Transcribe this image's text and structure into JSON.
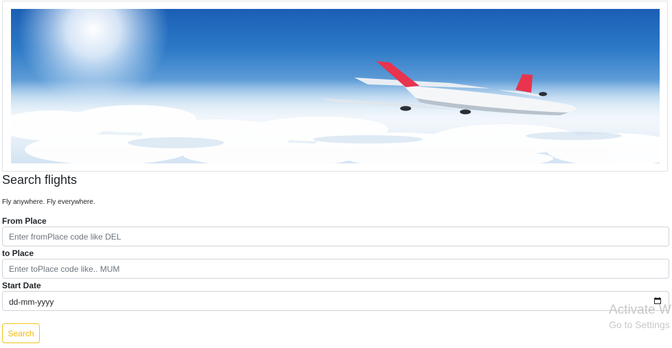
{
  "hero": {
    "alt": "airplane-above-clouds"
  },
  "search": {
    "title": "Search flights",
    "subtitle": "Fly anywhere. Fly everywhere.",
    "from_label": "From Place",
    "from_placeholder": "Enter fromPlace code like DEL",
    "to_label": "to Place",
    "to_placeholder": "Enter toPlace code like.. MUM",
    "date_label": "Start Date",
    "date_value": "dd-mm-yyyy",
    "button_label": "Search"
  },
  "watermark": {
    "title": "Activate W",
    "subtitle": "Go to Settings"
  },
  "colors": {
    "button_accent": "#f0b90b",
    "plane_tail": "#e8344e",
    "sky": "#2b78c6"
  },
  "icons": {
    "calendar": "calendar-icon"
  }
}
